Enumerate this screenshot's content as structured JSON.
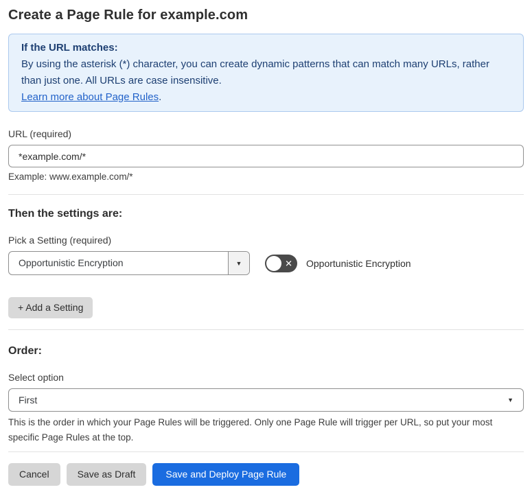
{
  "page": {
    "title": "Create a Page Rule for example.com"
  },
  "info_box": {
    "heading": "If the URL matches:",
    "body": "By using the asterisk (*) character, you can create dynamic patterns that can match many URLs, rather than just one. All URLs are case insensitive.",
    "link_text": "Learn more about Page Rules",
    "link_suffix": "."
  },
  "url_field": {
    "label": "URL (required)",
    "value": "*example.com/*",
    "example": "Example: www.example.com/*"
  },
  "settings": {
    "heading": "Then the settings are:",
    "picker_label": "Pick a Setting (required)",
    "selected_setting": "Opportunistic Encryption",
    "toggle_state": "off",
    "toggle_label": "Opportunistic Encryption",
    "add_button_label": "+ Add a Setting"
  },
  "order": {
    "heading": "Order:",
    "label": "Select option",
    "selected_option": "First",
    "help": "This is the order in which your Page Rules will be triggered. Only one Page Rule will trigger per URL, so put your most specific Page Rules at the top."
  },
  "footer": {
    "cancel_label": "Cancel",
    "save_draft_label": "Save as Draft",
    "save_deploy_label": "Save and Deploy Page Rule"
  },
  "icons": {
    "dropdown_arrow": "▼",
    "toggle_off_x": "✕"
  },
  "colors": {
    "accent_blue": "#1a6ce0",
    "info_bg": "#e8f2fc",
    "info_border": "#abc9ee",
    "info_text": "#1d3f72",
    "link_blue": "#2262c9",
    "toggle_off_bg": "#4a4a4a",
    "button_gray": "#d6d6d6"
  }
}
